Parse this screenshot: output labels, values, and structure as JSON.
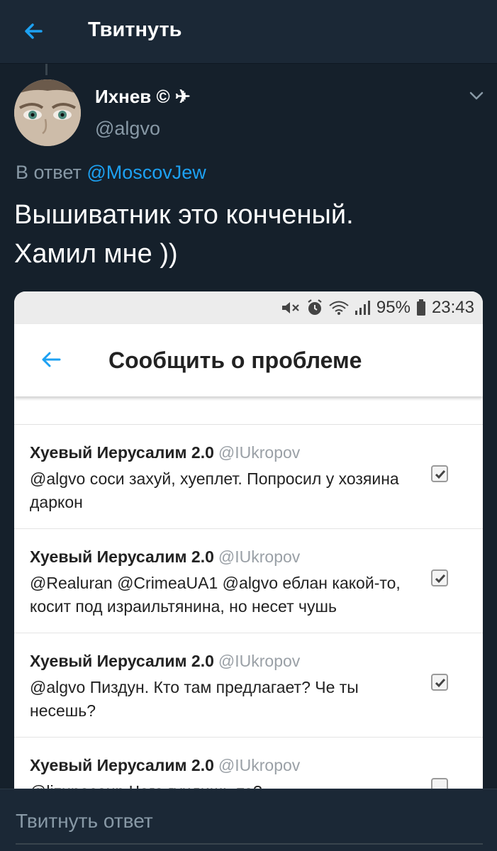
{
  "header": {
    "title": "Твитнуть",
    "back_icon": "arrow-left-icon"
  },
  "tweet": {
    "author_name": "Ихнев © ✈",
    "author_handle": "@algvo",
    "reply_prefix": "В ответ",
    "reply_mention": "@MoscovJew",
    "text_line1": "Вышиватник это конченый.",
    "text_line2": "Хамил мне ))"
  },
  "screenshot": {
    "status_bar": {
      "battery": "95%",
      "time": "23:43"
    },
    "app_bar_title": "Сообщить о проблеме",
    "items": [
      {
        "name": "Хуевый Иерусалим 2.0",
        "handle": "@IUkropov",
        "text": "@algvo соси захуй,  хуеплет.  Попросил у хозяина  даркон",
        "checked": true
      },
      {
        "name": "Хуевый Иерусалим 2.0",
        "handle": "@IUkropov",
        "text": "@Realuran @CrimeaUA1 @algvo еблан какой-то,  косит под израильтянина,  но несет чушь",
        "checked": true
      },
      {
        "name": "Хуевый Иерусалим 2.0",
        "handle": "@IUkropov",
        "text": "@algvo Пиздун.  Кто там предлагает? Че ты несешь?",
        "checked": true
      },
      {
        "name": "Хуевый Иерусалим 2.0",
        "handle": "@IUkropov",
        "text": "@lizunecoup Чего гундишь-то?",
        "checked": false
      }
    ]
  },
  "reply_placeholder": "Твитнуть ответ",
  "colors": {
    "background": "#15202b",
    "bar": "#1b2836",
    "accent": "#1da1f2",
    "muted": "#8899a6"
  }
}
